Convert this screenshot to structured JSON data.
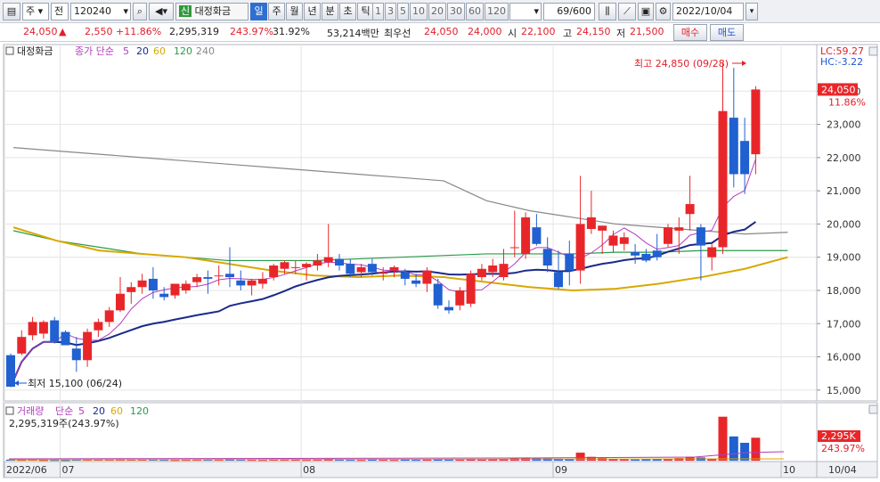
{
  "toolbar": {
    "period_select": "주",
    "prev_label": "전",
    "code": "120240",
    "new_badge": "신",
    "stock_name": "대정화금",
    "tabs": [
      "일",
      "주",
      "월",
      "년",
      "분",
      "초",
      "틱"
    ],
    "active_tab": "일",
    "intervals": [
      "1",
      "3",
      "5",
      "10",
      "20",
      "30",
      "60",
      "120"
    ],
    "count": "69/600",
    "date": "2022/10/04"
  },
  "quote": {
    "price": "24,050",
    "change": "2,550",
    "change_pct": "+11.86%",
    "volume": "2,295,319",
    "volume_ratio": "243.97%",
    "turnover": "31.92%",
    "amount": "53,214백만",
    "best_label": "최우선",
    "best_ask": "24,050",
    "best_bid": "24,000",
    "open_label": "시",
    "open": "22,100",
    "high_label": "고",
    "high": "24,150",
    "low_label": "저",
    "low": "21,500",
    "buy_label": "매수",
    "sell_label": "매도"
  },
  "legend": {
    "name": "대정화금",
    "ma_label": "종가 단순",
    "ma_periods": [
      "5",
      "20",
      "60",
      "120",
      "240"
    ],
    "ma_colors": [
      "#b43cc0",
      "#1a2a8a",
      "#d8a800",
      "#2a9a4a",
      "#888888"
    ],
    "lc": "LC:59.27",
    "hc": "HC:-3.22",
    "vol_label": "거래량",
    "vol_ma_label": "단순",
    "vol_periods": [
      "5",
      "20",
      "60",
      "120"
    ],
    "vol_value": "2,295,319주(243.97%)"
  },
  "annotations": {
    "high": "최고 24,850 (09/28)",
    "low": "최저 15,100 (06/24)",
    "last_price": "24,050",
    "last_pct": "11.86%",
    "last_vol": "2,295K",
    "last_vol_pct": "243.97%"
  },
  "price_axis": [
    "24,000",
    "23,000",
    "22,000",
    "21,000",
    "20,000",
    "19,000",
    "18,000",
    "17,000",
    "16,000",
    "15,000"
  ],
  "date_labels": [
    "2022/06",
    "07",
    "08",
    "09",
    "10"
  ],
  "date_right": "10/04",
  "colors": {
    "up": "#e8262a",
    "down": "#2060d0"
  },
  "chart_data": {
    "type": "candlestick",
    "ylim": [
      14700,
      25000
    ],
    "candles": [
      {
        "o": 16050,
        "h": 16100,
        "l": 15100,
        "c": 15100
      },
      {
        "o": 16100,
        "h": 16800,
        "l": 16050,
        "c": 16600
      },
      {
        "o": 16650,
        "h": 17200,
        "l": 16500,
        "c": 17050
      },
      {
        "o": 16700,
        "h": 17100,
        "l": 16550,
        "c": 17050
      },
      {
        "o": 17100,
        "h": 17200,
        "l": 16400,
        "c": 16450
      },
      {
        "o": 16750,
        "h": 16800,
        "l": 16400,
        "c": 16350
      },
      {
        "o": 16250,
        "h": 16600,
        "l": 15550,
        "c": 15900
      },
      {
        "o": 15900,
        "h": 16850,
        "l": 15700,
        "c": 16750
      },
      {
        "o": 16800,
        "h": 17150,
        "l": 16600,
        "c": 17050
      },
      {
        "o": 17050,
        "h": 17500,
        "l": 16900,
        "c": 17400
      },
      {
        "o": 17400,
        "h": 18400,
        "l": 17350,
        "c": 17900
      },
      {
        "o": 17950,
        "h": 18250,
        "l": 17600,
        "c": 18100
      },
      {
        "o": 18100,
        "h": 18500,
        "l": 17900,
        "c": 18300
      },
      {
        "o": 18350,
        "h": 18700,
        "l": 17750,
        "c": 18000
      },
      {
        "o": 17900,
        "h": 18100,
        "l": 17700,
        "c": 17800
      },
      {
        "o": 17850,
        "h": 18200,
        "l": 17750,
        "c": 18200
      },
      {
        "o": 18000,
        "h": 18300,
        "l": 17900,
        "c": 18200
      },
      {
        "o": 18250,
        "h": 18500,
        "l": 18100,
        "c": 18400
      },
      {
        "o": 18400,
        "h": 18600,
        "l": 17900,
        "c": 18350
      },
      {
        "o": 18450,
        "h": 18750,
        "l": 18150,
        "c": 18450
      },
      {
        "o": 18500,
        "h": 19300,
        "l": 18100,
        "c": 18400
      },
      {
        "o": 18300,
        "h": 18600,
        "l": 18000,
        "c": 18150
      },
      {
        "o": 18150,
        "h": 18350,
        "l": 17850,
        "c": 18300
      },
      {
        "o": 18200,
        "h": 18550,
        "l": 18050,
        "c": 18350
      },
      {
        "o": 18400,
        "h": 18800,
        "l": 18300,
        "c": 18750
      },
      {
        "o": 18650,
        "h": 18900,
        "l": 18500,
        "c": 18850
      },
      {
        "o": 18700,
        "h": 18900,
        "l": 18500,
        "c": 18700
      },
      {
        "o": 18700,
        "h": 18850,
        "l": 18300,
        "c": 18800
      },
      {
        "o": 18750,
        "h": 19100,
        "l": 18600,
        "c": 18900
      },
      {
        "o": 18850,
        "h": 20000,
        "l": 18700,
        "c": 19000
      },
      {
        "o": 18950,
        "h": 19100,
        "l": 18600,
        "c": 18750
      },
      {
        "o": 18800,
        "h": 18950,
        "l": 18400,
        "c": 18500
      },
      {
        "o": 18550,
        "h": 18800,
        "l": 18400,
        "c": 18700
      },
      {
        "o": 18800,
        "h": 18950,
        "l": 18450,
        "c": 18550
      },
      {
        "o": 18500,
        "h": 18700,
        "l": 18300,
        "c": 18550
      },
      {
        "o": 18600,
        "h": 18750,
        "l": 18400,
        "c": 18700
      },
      {
        "o": 18550,
        "h": 18650,
        "l": 18150,
        "c": 18350
      },
      {
        "o": 18300,
        "h": 18500,
        "l": 18100,
        "c": 18200
      },
      {
        "o": 18200,
        "h": 18700,
        "l": 17950,
        "c": 18600
      },
      {
        "o": 18200,
        "h": 18350,
        "l": 17450,
        "c": 17550
      },
      {
        "o": 17500,
        "h": 17700,
        "l": 17300,
        "c": 17400
      },
      {
        "o": 17550,
        "h": 18100,
        "l": 17400,
        "c": 18000
      },
      {
        "o": 17600,
        "h": 18600,
        "l": 17500,
        "c": 18500
      },
      {
        "o": 18400,
        "h": 18800,
        "l": 18300,
        "c": 18650
      },
      {
        "o": 18550,
        "h": 18950,
        "l": 18400,
        "c": 18750
      },
      {
        "o": 18400,
        "h": 19250,
        "l": 18300,
        "c": 18800
      },
      {
        "o": 19300,
        "h": 20400,
        "l": 19000,
        "c": 19300
      },
      {
        "o": 19100,
        "h": 20350,
        "l": 18950,
        "c": 20200
      },
      {
        "o": 19900,
        "h": 20300,
        "l": 19350,
        "c": 19400
      },
      {
        "o": 19250,
        "h": 19600,
        "l": 18550,
        "c": 18750
      },
      {
        "o": 18550,
        "h": 19200,
        "l": 18050,
        "c": 18100
      },
      {
        "o": 19100,
        "h": 19500,
        "l": 18150,
        "c": 18600
      },
      {
        "o": 18600,
        "h": 21450,
        "l": 18200,
        "c": 20000
      },
      {
        "o": 19850,
        "h": 21000,
        "l": 19700,
        "c": 20200
      },
      {
        "o": 19800,
        "h": 19950,
        "l": 19100,
        "c": 19950
      },
      {
        "o": 19350,
        "h": 19800,
        "l": 19150,
        "c": 19650
      },
      {
        "o": 19400,
        "h": 19750,
        "l": 19200,
        "c": 19600
      },
      {
        "o": 19150,
        "h": 19400,
        "l": 18800,
        "c": 19050
      },
      {
        "o": 19100,
        "h": 19250,
        "l": 18850,
        "c": 18900
      },
      {
        "o": 19200,
        "h": 19700,
        "l": 18900,
        "c": 19000
      },
      {
        "o": 19400,
        "h": 20000,
        "l": 19300,
        "c": 19900
      },
      {
        "o": 19800,
        "h": 20200,
        "l": 19100,
        "c": 19900
      },
      {
        "o": 20300,
        "h": 21450,
        "l": 19800,
        "c": 20600
      },
      {
        "o": 19900,
        "h": 20000,
        "l": 18300,
        "c": 19350
      },
      {
        "o": 19000,
        "h": 19400,
        "l": 18600,
        "c": 19300
      },
      {
        "o": 19300,
        "h": 24850,
        "l": 19100,
        "c": 23400
      },
      {
        "o": 23200,
        "h": 24700,
        "l": 21100,
        "c": 21500
      },
      {
        "o": 22500,
        "h": 23200,
        "l": 20900,
        "c": 21500
      },
      {
        "o": 22100,
        "h": 24150,
        "l": 21500,
        "c": 24050
      }
    ],
    "volume_ylim": [
      0,
      1400000
    ],
    "volume": [
      30000,
      25000,
      28000,
      20000,
      22000,
      18000,
      40000,
      35000,
      30000,
      28000,
      45000,
      30000,
      30000,
      35000,
      25000,
      22000,
      25000,
      28000,
      30000,
      28000,
      50000,
      30000,
      25000,
      22000,
      30000,
      35000,
      28000,
      25000,
      30000,
      60000,
      30000,
      25000,
      22000,
      28000,
      25000,
      22000,
      30000,
      25000,
      28000,
      40000,
      35000,
      30000,
      45000,
      35000,
      40000,
      50000,
      90000,
      100000,
      80000,
      70000,
      60000,
      50000,
      250000,
      120000,
      80000,
      50000,
      40000,
      35000,
      40000,
      50000,
      60000,
      80000,
      120000,
      100000,
      60000,
      1380000,
      760000,
      560000,
      720000
    ]
  }
}
